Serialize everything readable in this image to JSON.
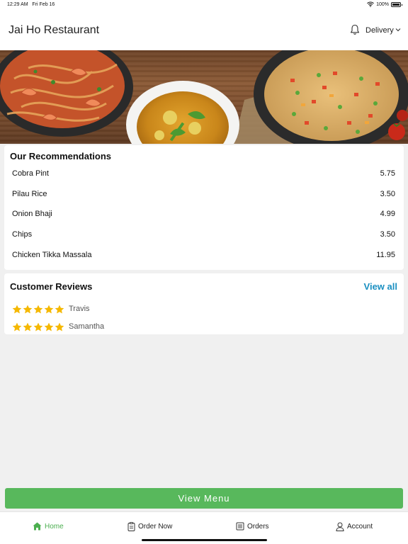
{
  "status_bar": {
    "time": "12:29 AM",
    "date": "Fri Feb 16",
    "battery": "100%",
    "battery_level": 1.0,
    "icons": [
      "wifi-icon",
      "battery-icon"
    ]
  },
  "header": {
    "title": "Jai Ho Restaurant",
    "delivery_label": "Delivery",
    "icons": [
      "bell-icon",
      "chevron-down-icon"
    ]
  },
  "banner": {
    "description_icon": "food-banner-image"
  },
  "recommendations": {
    "title": "Our Recommendations",
    "items": [
      {
        "name": "Cobra Pint",
        "price": "5.75"
      },
      {
        "name": "Pilau Rice",
        "price": "3.50"
      },
      {
        "name": "Onion Bhaji",
        "price": "4.99"
      },
      {
        "name": "Chips",
        "price": "3.50"
      },
      {
        "name": "Chicken Tikka Massala",
        "price": "11.95"
      }
    ]
  },
  "reviews": {
    "title": "Customer Reviews",
    "view_all": "View all",
    "items": [
      {
        "name": "Travis",
        "rating": 5
      },
      {
        "name": "Samantha",
        "rating": 5
      }
    ]
  },
  "view_menu_label": "View Menu",
  "tabs": [
    {
      "label": "Home",
      "icon": "home-icon",
      "active": true
    },
    {
      "label": "Order Now",
      "icon": "order-icon",
      "active": false
    },
    {
      "label": "Orders",
      "icon": "orders-list-icon",
      "active": false
    },
    {
      "label": "Account",
      "icon": "account-icon",
      "active": false
    }
  ],
  "colors": {
    "accent_green": "#58b85c",
    "link_blue": "#1a8fc1",
    "star_yellow": "#f5b800",
    "background": "#f0f0f0"
  }
}
